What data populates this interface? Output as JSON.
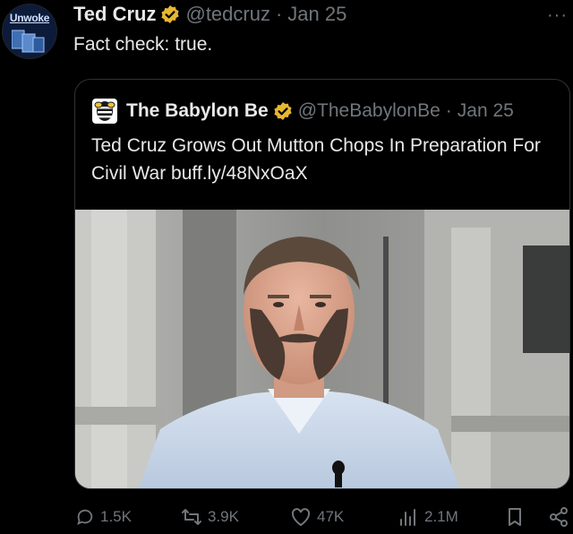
{
  "author": {
    "avatar_text": "Unwoke",
    "name": "Ted Cruz",
    "handle": "@tedcruz",
    "separator": "·",
    "date": "Jan 25"
  },
  "more_label": "···",
  "tweet_text": "Fact check: true.",
  "quote": {
    "name": "The Babylon Be",
    "handle": "@TheBabylonBe",
    "separator": "·",
    "date": "Jan 25",
    "text": "Ted Cruz Grows Out Mutton Chops In Preparation For Civil War buff.ly/48NxOaX"
  },
  "actions": {
    "replies": "1.5K",
    "reposts": "3.9K",
    "likes": "47K",
    "views": "2.1M"
  },
  "colors": {
    "background": "#000000",
    "text": "#e7e9ea",
    "muted": "#71767b",
    "verified_gold": "#e8b730",
    "border": "#2f3336"
  }
}
